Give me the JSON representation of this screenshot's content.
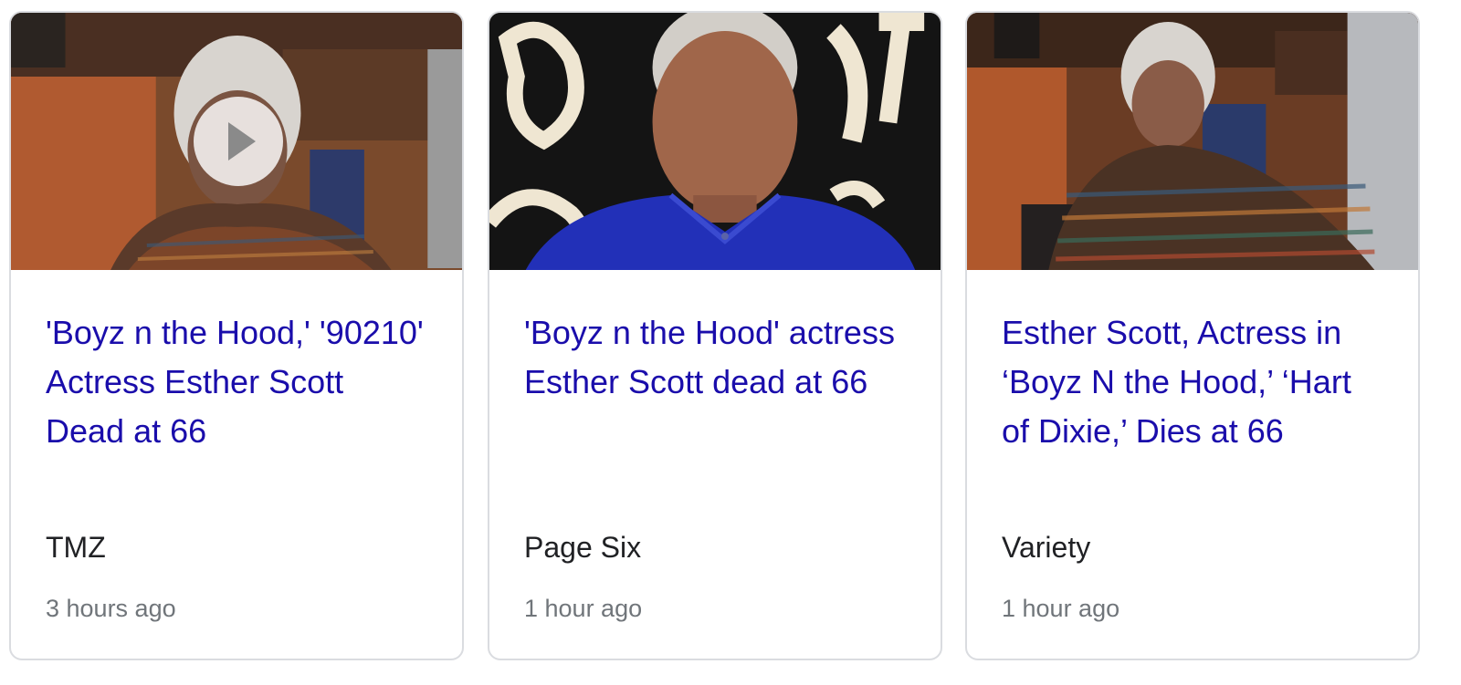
{
  "news_cards": [
    {
      "headline": "'Boyz n the Hood,' '90210' Actress Esther Scott Dead at 66",
      "source": "TMZ",
      "time": "3 hours ago",
      "has_video": true,
      "thumbnail_icon": "video-thumbnail-image"
    },
    {
      "headline": "'Boyz n the Hood' actress Esther Scott dead at 66",
      "source": "Page Six",
      "time": "1 hour ago",
      "has_video": false,
      "thumbnail_icon": "article-thumbnail-image"
    },
    {
      "headline": "Esther Scott, Actress in ‘Boyz N the Hood,’ ‘Hart of Dixie,’ Dies at 66",
      "source": "Variety",
      "time": "1 hour ago",
      "has_video": false,
      "thumbnail_icon": "article-thumbnail-image"
    }
  ],
  "colors": {
    "headline_link": "#1a0dab",
    "source_text": "#202124",
    "time_text": "#70757a",
    "card_border": "#dadce0"
  }
}
